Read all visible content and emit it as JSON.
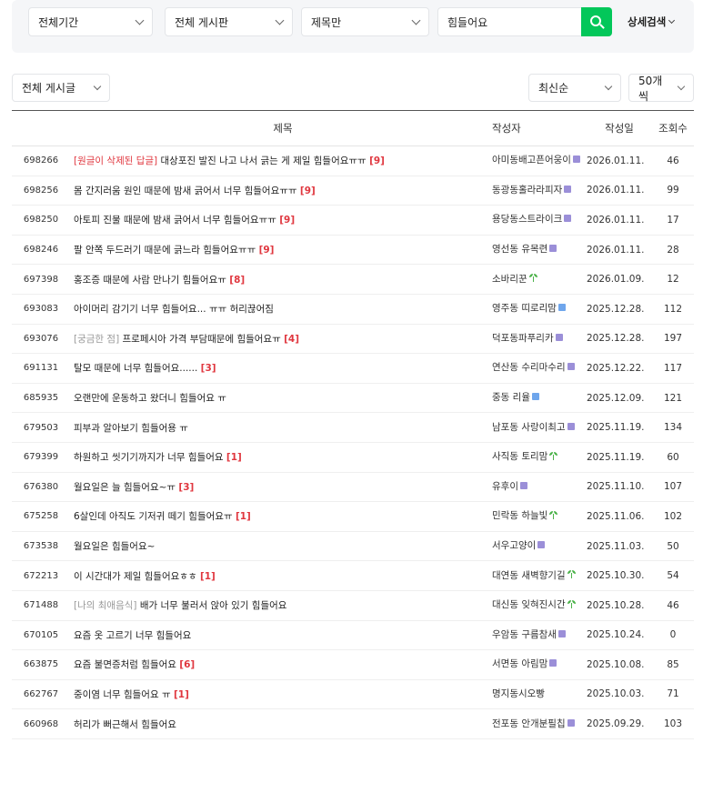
{
  "search": {
    "period": "전체기간",
    "board": "전체 게시판",
    "scope": "제목만",
    "query": "힘들어요",
    "advanced": "상세검색"
  },
  "filters": {
    "category": "전체 게시글",
    "sort": "최신순",
    "per_page": "50개씩"
  },
  "table": {
    "headers": {
      "title": "제목",
      "author": "작성자",
      "date": "작성일",
      "views": "조회수"
    },
    "rows": [
      {
        "no": "698266",
        "prefix": "[원글이 삭제된 답글]",
        "prefix_style": "red",
        "title": " 대상포진 발진 나고 나서 긁는 게 제일 힘들어요ㅠㅠ",
        "count": "[9]",
        "author": "아미동배고픈어웅이",
        "badge": "purple-level",
        "date": "2026.01.11.",
        "views": "46"
      },
      {
        "no": "698256",
        "prefix": "",
        "prefix_style": "",
        "title": "몸 간지러움 원인 때문에 밤새 긁어서 너무 힘들어요ㅠㅠ",
        "count": "[9]",
        "author": "동광동홀라라피자",
        "badge": "purple-level",
        "date": "2026.01.11.",
        "views": "99"
      },
      {
        "no": "698250",
        "prefix": "",
        "prefix_style": "",
        "title": "아토피 진물 때문에 밤새 긁어서 너무 힘들어요ㅠㅠ",
        "count": "[9]",
        "author": "용당동스트라이크",
        "badge": "purple-level",
        "date": "2026.01.11.",
        "views": "17"
      },
      {
        "no": "698246",
        "prefix": "",
        "prefix_style": "",
        "title": "팔 안쪽 두드러기 때문에 긁느라 힘들어요ㅠㅠ",
        "count": "[9]",
        "author": "영선동 유목련",
        "badge": "purple-level",
        "date": "2026.01.11.",
        "views": "28"
      },
      {
        "no": "697398",
        "prefix": "",
        "prefix_style": "",
        "title": "홍조증 때문에 사람 만나기 힘들어요ㅠ",
        "count": "[8]",
        "author": "소바리꾼",
        "badge": "sprout",
        "date": "2026.01.09.",
        "views": "12"
      },
      {
        "no": "693083",
        "prefix": "",
        "prefix_style": "",
        "title": "아이머리 감기기 너무 힘들어요... ㅠㅠ 허리끊어짐",
        "count": "",
        "author": "영주동 띠로리맘",
        "badge": "blue-level",
        "date": "2025.12.28.",
        "views": "112"
      },
      {
        "no": "693076",
        "prefix": "[궁금한 점]",
        "prefix_style": "gray",
        "title": " 프로페시아 가격 부담때문에 힘들어요ㅠ",
        "count": "[4]",
        "author": "덕포동파푸리카",
        "badge": "purple-level",
        "date": "2025.12.28.",
        "views": "197"
      },
      {
        "no": "691131",
        "prefix": "",
        "prefix_style": "",
        "title": "탈모 때문에 너무 힘들어요......",
        "count": "[3]",
        "author": "연산동 수리마수리",
        "badge": "purple-level",
        "date": "2025.12.22.",
        "views": "117"
      },
      {
        "no": "685935",
        "prefix": "",
        "prefix_style": "",
        "title": "오랜만에 운동하고 왔더니 힘들어요 ㅠ",
        "count": "",
        "author": "중동 리율",
        "badge": "blue-level",
        "date": "2025.12.09.",
        "views": "121"
      },
      {
        "no": "679503",
        "prefix": "",
        "prefix_style": "",
        "title": "피부과 알아보기 힘들어용 ㅠ",
        "count": "",
        "author": "남포동 사랑이최고",
        "badge": "purple-level",
        "date": "2025.11.19.",
        "views": "134"
      },
      {
        "no": "679399",
        "prefix": "",
        "prefix_style": "",
        "title": "하원하고 씻기기까지가 너무 힘들어요",
        "count": "[1]",
        "author": "사직동 토리맘",
        "badge": "sprout",
        "date": "2025.11.19.",
        "views": "60"
      },
      {
        "no": "676380",
        "prefix": "",
        "prefix_style": "",
        "title": "월요일은 늘 힘들어요~ㅠ",
        "count": "[3]",
        "author": "유후이",
        "badge": "purple-level",
        "date": "2025.11.10.",
        "views": "107"
      },
      {
        "no": "675258",
        "prefix": "",
        "prefix_style": "",
        "title": "6살인데 아직도 기저귀 떼기 힘들어요ㅠ",
        "count": "[1]",
        "author": "민락동 하늘빛",
        "badge": "sprout",
        "date": "2025.11.06.",
        "views": "102"
      },
      {
        "no": "673538",
        "prefix": "",
        "prefix_style": "",
        "title": "월요일은 힘들어요~",
        "count": "",
        "author": "서우고양이",
        "badge": "purple-level",
        "date": "2025.11.03.",
        "views": "50"
      },
      {
        "no": "672213",
        "prefix": "",
        "prefix_style": "",
        "title": "이 시간대가 제일 힘들어요ㅎㅎ",
        "count": "[1]",
        "author": "대연동 새벽향기길",
        "badge": "sprout",
        "date": "2025.10.30.",
        "views": "54"
      },
      {
        "no": "671488",
        "prefix": "[나의 최애음식]",
        "prefix_style": "gray",
        "title": " 배가 너무 불러서 앉아 있기 힘들어요",
        "count": "",
        "author": "대신동 잊혀진시간",
        "badge": "sprout",
        "date": "2025.10.28.",
        "views": "46"
      },
      {
        "no": "670105",
        "prefix": "",
        "prefix_style": "",
        "title": "요즘 옷 고르기 너무 힘들어요",
        "count": "",
        "author": "우암동 구름참새",
        "badge": "purple-level",
        "date": "2025.10.24.",
        "views": "0"
      },
      {
        "no": "663875",
        "prefix": "",
        "prefix_style": "",
        "title": "요즘 불면증처럼 힘들어요",
        "count": "[6]",
        "author": "서면동 아림맘",
        "badge": "purple-level",
        "date": "2025.10.08.",
        "views": "85"
      },
      {
        "no": "662767",
        "prefix": "",
        "prefix_style": "",
        "title": "중이염 너무 힘들어요 ㅠ",
        "count": "[1]",
        "author": "명지동시오빵",
        "badge": "",
        "date": "2025.10.03.",
        "views": "71"
      },
      {
        "no": "660968",
        "prefix": "",
        "prefix_style": "",
        "title": "허리가 뻐근해서 힘들어요",
        "count": "",
        "author": "전포동 안개분필칩",
        "badge": "purple-level",
        "date": "2025.09.29.",
        "views": "103"
      }
    ]
  }
}
